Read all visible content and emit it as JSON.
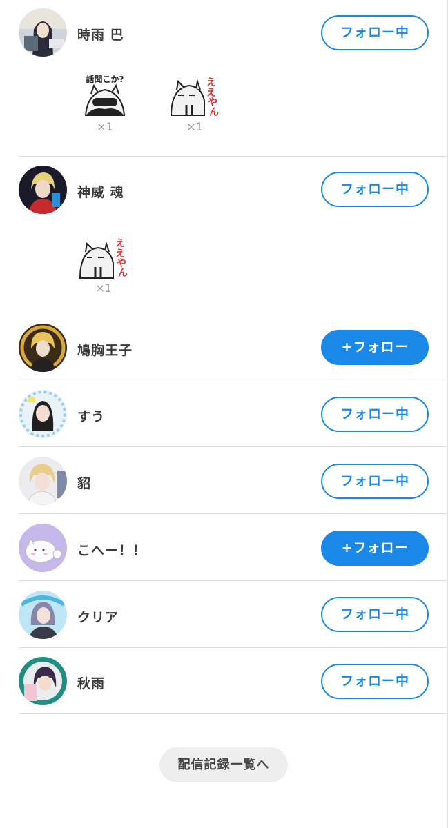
{
  "users": [
    {
      "name": "時雨 巴",
      "follow_label": "フォロー中",
      "following": true,
      "gifts": [
        {
          "text": "話聞こか?",
          "count": "×1"
        },
        {
          "text": "ええやん",
          "count": "×1"
        }
      ]
    },
    {
      "name": "神威 魂",
      "follow_label": "フォロー中",
      "following": true,
      "gifts": [
        {
          "text": "ええやん",
          "count": "×1"
        }
      ]
    },
    {
      "name": "鳩胸王子",
      "follow_label": "+フォロー",
      "following": false,
      "gifts": []
    },
    {
      "name": "すう",
      "follow_label": "フォロー中",
      "following": true,
      "gifts": []
    },
    {
      "name": "貂",
      "follow_label": "フォロー中",
      "following": true,
      "gifts": []
    },
    {
      "name": "こへー！！",
      "follow_label": "+フォロー",
      "following": false,
      "gifts": []
    },
    {
      "name": "クリア",
      "follow_label": "フォロー中",
      "following": true,
      "gifts": []
    },
    {
      "name": "秋雨",
      "follow_label": "フォロー中",
      "following": true,
      "gifts": []
    }
  ],
  "history_button_label": "配信記録一覧へ",
  "colors": {
    "accent": "#1a88e6",
    "divider": "#dcdcdc",
    "text": "#3a3a3a",
    "muted": "#999999"
  }
}
